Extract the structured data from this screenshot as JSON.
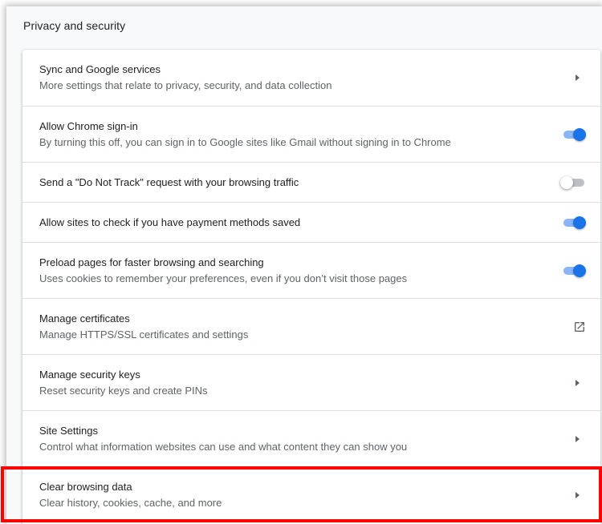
{
  "section": {
    "title": "Privacy and security"
  },
  "rows": [
    {
      "label": "Sync and Google services",
      "sub": "More settings that relate to privacy, security, and data collection",
      "control": "arrow"
    },
    {
      "label": "Allow Chrome sign-in",
      "sub": "By turning this off, you can sign in to Google sites like Gmail without signing in to Chrome",
      "control": "toggle",
      "checked": true
    },
    {
      "label": "Send a \"Do Not Track\" request with your browsing traffic",
      "sub": "",
      "control": "toggle",
      "checked": false
    },
    {
      "label": "Allow sites to check if you have payment methods saved",
      "sub": "",
      "control": "toggle",
      "checked": true
    },
    {
      "label": "Preload pages for faster browsing and searching",
      "sub": "Uses cookies to remember your preferences, even if you don’t visit those pages",
      "control": "toggle",
      "checked": true
    },
    {
      "label": "Manage certificates",
      "sub": "Manage HTTPS/SSL certificates and settings",
      "control": "external-link"
    },
    {
      "label": "Manage security keys",
      "sub": "Reset security keys and create PINs",
      "control": "arrow"
    },
    {
      "label": "Site Settings",
      "sub": "Control what information websites can use and what content they can show you",
      "control": "arrow"
    },
    {
      "label": "Clear browsing data",
      "sub": "Clear history, cookies, cache, and more",
      "control": "arrow",
      "highlighted": true
    }
  ],
  "colors": {
    "accent": "#1a73e8",
    "highlight": "#ff0000",
    "text_primary": "#202124",
    "text_secondary": "#5f6368"
  },
  "icons": {
    "arrow": "chevron-right-icon",
    "external": "open-in-new-icon"
  }
}
